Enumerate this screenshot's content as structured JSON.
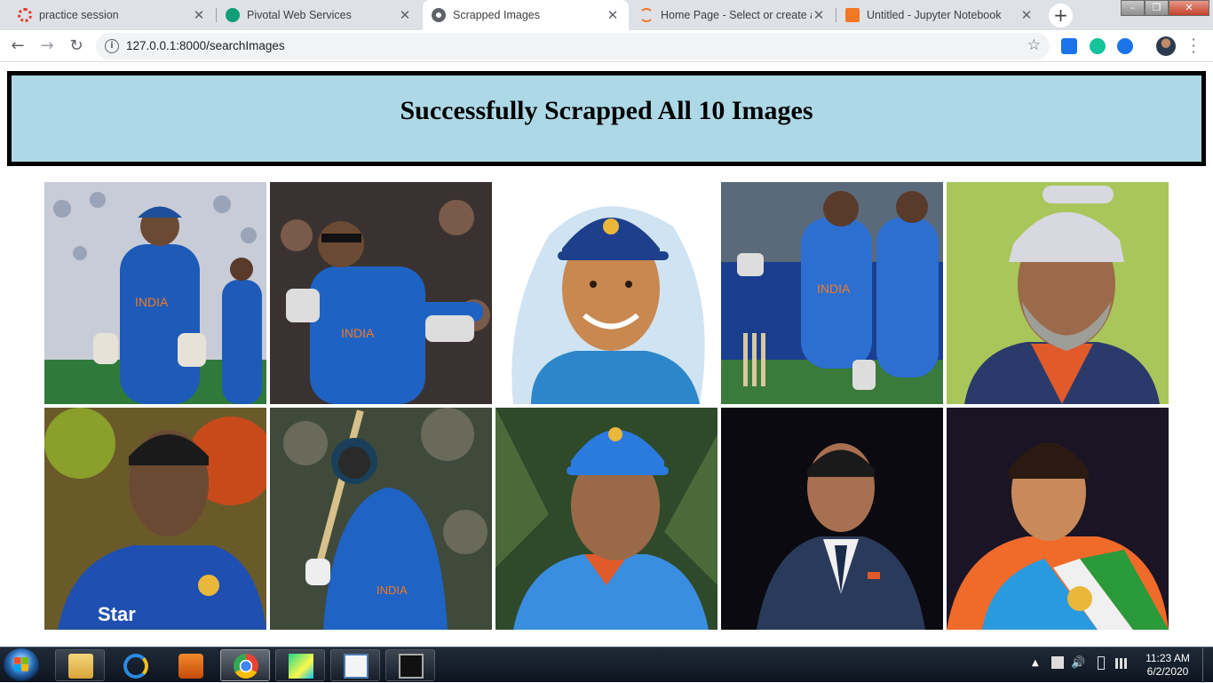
{
  "browser": {
    "tabs": [
      {
        "title": "practice session",
        "icon": "red-circle-icon",
        "active": false
      },
      {
        "title": "Pivotal Web Services",
        "icon": "pivotal-icon",
        "active": false
      },
      {
        "title": "Scrapped Images",
        "icon": "globe-icon",
        "active": true
      },
      {
        "title": "Home Page - Select or create a",
        "icon": "jupyter-icon",
        "active": false
      },
      {
        "title": "Untitled - Jupyter Notebook",
        "icon": "notebook-icon",
        "active": false
      }
    ],
    "close_glyph": "✕",
    "new_tab_glyph": "+",
    "url": "127.0.0.1:8000/searchImages",
    "info_glyph": "i",
    "bookmark_glyph": "☆"
  },
  "page": {
    "heading": "Successfully Scrapped All 10 Images",
    "banner_background": "#add8e6",
    "images": [
      {
        "description_icon": "cricketer-wicketkeeper-icon"
      },
      {
        "description_icon": "cricketer-keeping-icon"
      },
      {
        "description_icon": "cricketer-portrait-painting-icon"
      },
      {
        "description_icon": "cricketer-stumping-icon"
      },
      {
        "description_icon": "cricketer-cap-closeup-icon"
      },
      {
        "description_icon": "cricketer-looking-up-icon"
      },
      {
        "description_icon": "cricketer-batting-icon"
      },
      {
        "description_icon": "cricketer-helmet-cap-icon"
      },
      {
        "description_icon": "man-in-suit-icon"
      },
      {
        "description_icon": "cricketer-tricolor-jersey-icon"
      }
    ]
  },
  "taskbar": {
    "pinned": [
      "explorer-icon",
      "internet-explorer-icon",
      "media-player-icon",
      "chrome-icon",
      "pycharm-icon",
      "notepad-window-icon",
      "command-prompt-icon"
    ],
    "active_item": "chrome-icon",
    "time": "11:23 AM",
    "date": "6/2/2020"
  }
}
